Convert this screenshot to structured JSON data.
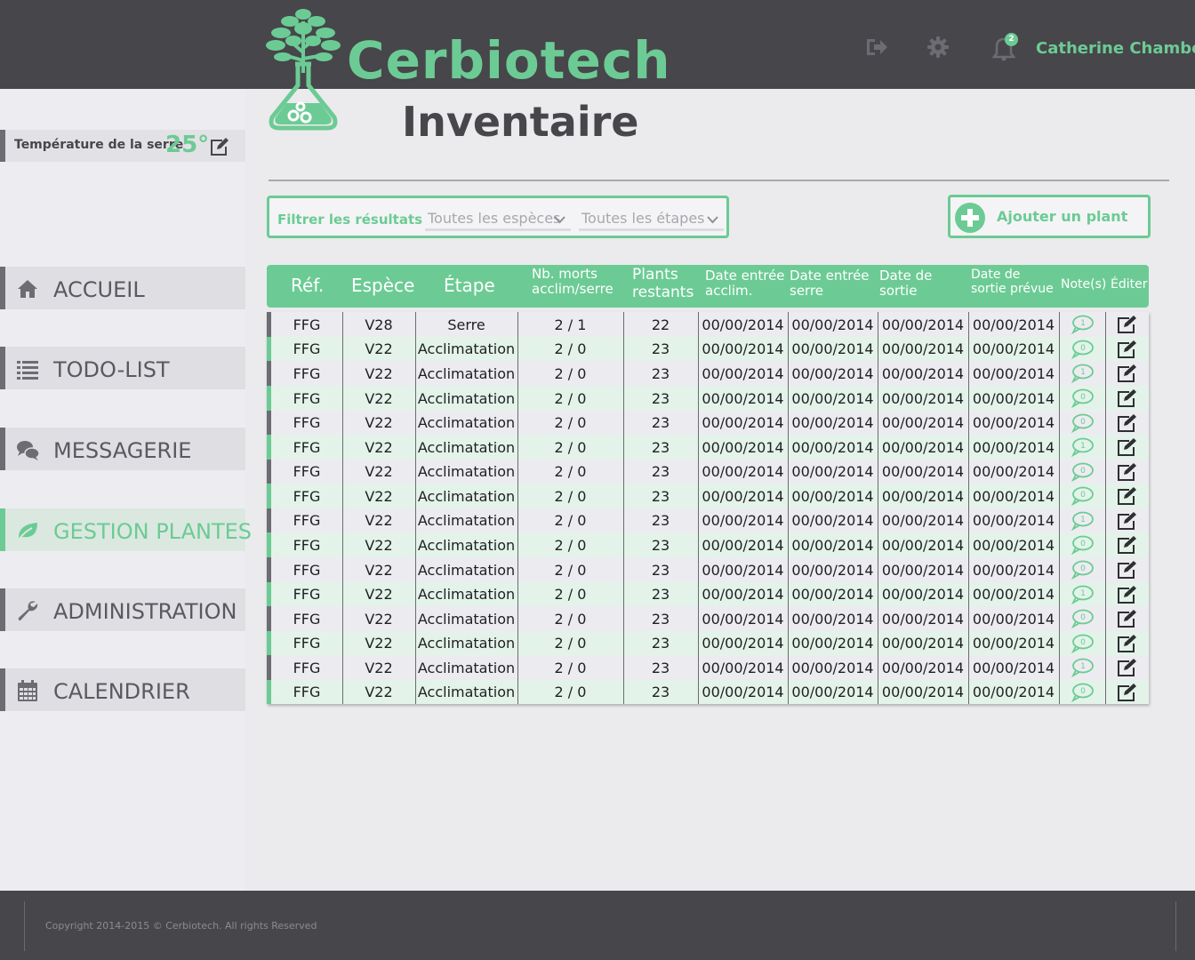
{
  "header": {
    "brand": "Cerbiotech",
    "notification_count": "2",
    "user_name": "Catherine Chambon",
    "icons": [
      "sign-out-icon",
      "gear-icon",
      "bell-icon"
    ]
  },
  "sidebar": {
    "temperature_label": "Température de la serre",
    "temperature_value": "25°",
    "items": [
      {
        "label": "ACCUEIL",
        "icon": "home-icon"
      },
      {
        "label": "TODO-LIST",
        "icon": "list-icon"
      },
      {
        "label": "MESSAGERIE",
        "icon": "chat-icon"
      },
      {
        "label": "GESTION PLANTES",
        "icon": "leaf-icon",
        "active": true
      },
      {
        "label": "ADMINISTRATION",
        "icon": "wrench-icon"
      },
      {
        "label": "CALENDRIER",
        "icon": "calendar-icon"
      }
    ]
  },
  "main": {
    "page_title": "Inventaire",
    "filter_label": "Filtrer les résultats :",
    "species_select": "Toutes les espèces",
    "stage_select": "Toutes les étapes",
    "add_button": "Ajouter un plant"
  },
  "table": {
    "headers": [
      "Réf.",
      "Espèce",
      "Étape",
      "Nb. morts\nacclim/serre",
      "Plants\nrestants",
      "Date entrée\nacclim.",
      "Date entrée\nserre",
      "Date de\nsortie",
      "Date de\nsortie prévue",
      "Note(s)",
      "Éditer"
    ],
    "rows": [
      {
        "ref": "FFG",
        "espece": "V28",
        "etape": "Serre",
        "morts": "2 / 1",
        "restants": "22",
        "d1": "00/00/2014",
        "d2": "00/00/2014",
        "d3": "00/00/2014",
        "d4": "00/00/2014",
        "notes": "1"
      },
      {
        "ref": "FFG",
        "espece": "V22",
        "etape": "Acclimatation",
        "morts": "2 / 0",
        "restants": "23",
        "d1": "00/00/2014",
        "d2": "00/00/2014",
        "d3": "00/00/2014",
        "d4": "00/00/2014",
        "notes": "0"
      },
      {
        "ref": "FFG",
        "espece": "V22",
        "etape": "Acclimatation",
        "morts": "2 / 0",
        "restants": "23",
        "d1": "00/00/2014",
        "d2": "00/00/2014",
        "d3": "00/00/2014",
        "d4": "00/00/2014",
        "notes": "1"
      },
      {
        "ref": "FFG",
        "espece": "V22",
        "etape": "Acclimatation",
        "morts": "2 / 0",
        "restants": "23",
        "d1": "00/00/2014",
        "d2": "00/00/2014",
        "d3": "00/00/2014",
        "d4": "00/00/2014",
        "notes": "0"
      },
      {
        "ref": "FFG",
        "espece": "V22",
        "etape": "Acclimatation",
        "morts": "2 / 0",
        "restants": "23",
        "d1": "00/00/2014",
        "d2": "00/00/2014",
        "d3": "00/00/2014",
        "d4": "00/00/2014",
        "notes": "0"
      },
      {
        "ref": "FFG",
        "espece": "V22",
        "etape": "Acclimatation",
        "morts": "2 / 0",
        "restants": "23",
        "d1": "00/00/2014",
        "d2": "00/00/2014",
        "d3": "00/00/2014",
        "d4": "00/00/2014",
        "notes": "1"
      },
      {
        "ref": "FFG",
        "espece": "V22",
        "etape": "Acclimatation",
        "morts": "2 / 0",
        "restants": "23",
        "d1": "00/00/2014",
        "d2": "00/00/2014",
        "d3": "00/00/2014",
        "d4": "00/00/2014",
        "notes": "0"
      },
      {
        "ref": "FFG",
        "espece": "V22",
        "etape": "Acclimatation",
        "morts": "2 / 0",
        "restants": "23",
        "d1": "00/00/2014",
        "d2": "00/00/2014",
        "d3": "00/00/2014",
        "d4": "00/00/2014",
        "notes": "0"
      },
      {
        "ref": "FFG",
        "espece": "V22",
        "etape": "Acclimatation",
        "morts": "2 / 0",
        "restants": "23",
        "d1": "00/00/2014",
        "d2": "00/00/2014",
        "d3": "00/00/2014",
        "d4": "00/00/2014",
        "notes": "1"
      },
      {
        "ref": "FFG",
        "espece": "V22",
        "etape": "Acclimatation",
        "morts": "2 / 0",
        "restants": "23",
        "d1": "00/00/2014",
        "d2": "00/00/2014",
        "d3": "00/00/2014",
        "d4": "00/00/2014",
        "notes": "0"
      },
      {
        "ref": "FFG",
        "espece": "V22",
        "etape": "Acclimatation",
        "morts": "2 / 0",
        "restants": "23",
        "d1": "00/00/2014",
        "d2": "00/00/2014",
        "d3": "00/00/2014",
        "d4": "00/00/2014",
        "notes": "0"
      },
      {
        "ref": "FFG",
        "espece": "V22",
        "etape": "Acclimatation",
        "morts": "2 / 0",
        "restants": "23",
        "d1": "00/00/2014",
        "d2": "00/00/2014",
        "d3": "00/00/2014",
        "d4": "00/00/2014",
        "notes": "1"
      },
      {
        "ref": "FFG",
        "espece": "V22",
        "etape": "Acclimatation",
        "morts": "2 / 0",
        "restants": "23",
        "d1": "00/00/2014",
        "d2": "00/00/2014",
        "d3": "00/00/2014",
        "d4": "00/00/2014",
        "notes": "0"
      },
      {
        "ref": "FFG",
        "espece": "V22",
        "etape": "Acclimatation",
        "morts": "2 / 0",
        "restants": "23",
        "d1": "00/00/2014",
        "d2": "00/00/2014",
        "d3": "00/00/2014",
        "d4": "00/00/2014",
        "notes": "0"
      },
      {
        "ref": "FFG",
        "espece": "V22",
        "etape": "Acclimatation",
        "morts": "2 / 0",
        "restants": "23",
        "d1": "00/00/2014",
        "d2": "00/00/2014",
        "d3": "00/00/2014",
        "d4": "00/00/2014",
        "notes": "1"
      },
      {
        "ref": "FFG",
        "espece": "V22",
        "etape": "Acclimatation",
        "morts": "2 / 0",
        "restants": "23",
        "d1": "00/00/2014",
        "d2": "00/00/2014",
        "d3": "00/00/2014",
        "d4": "00/00/2014",
        "notes": "0"
      }
    ]
  },
  "footer": {
    "copyright": "Copyright 2014-2015 © Cerbiotech. All rights Reserved"
  },
  "colors": {
    "accent": "#6ccb94",
    "dark": "#47464b",
    "row_alt": "#e3f3e9",
    "row_plain": "#ececf0"
  }
}
